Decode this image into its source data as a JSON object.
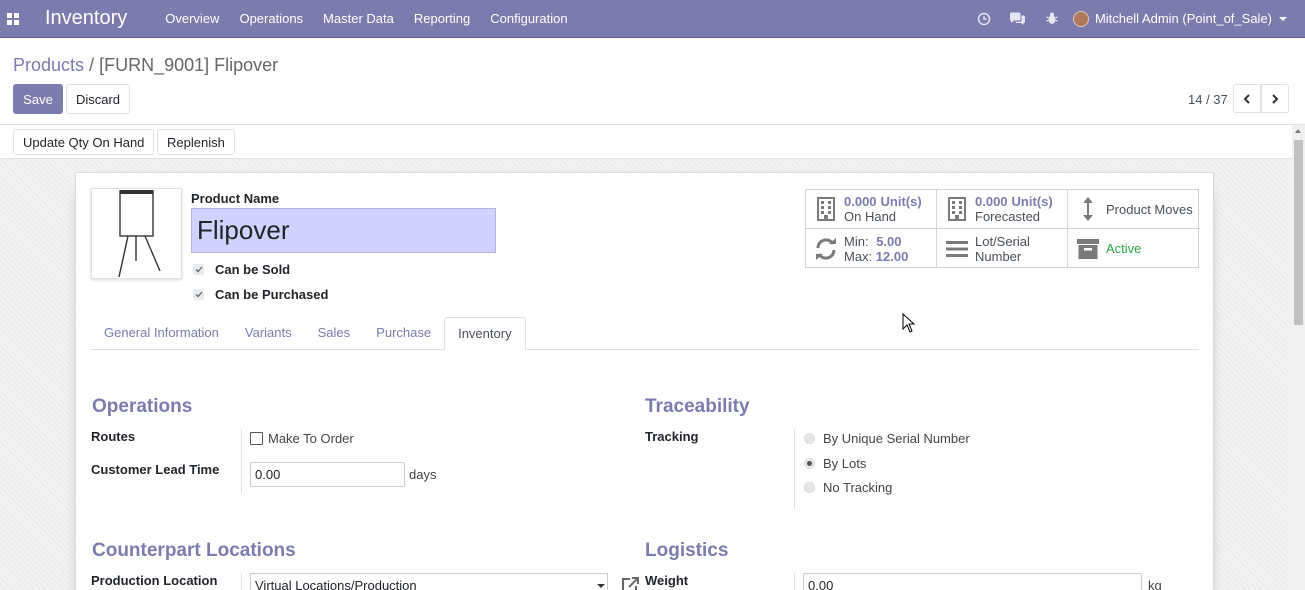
{
  "navbar": {
    "brand": "Inventory",
    "menu": [
      "Overview",
      "Operations",
      "Master Data",
      "Reporting",
      "Configuration"
    ],
    "user": "Mitchell Admin (Point_of_Sale)",
    "bg_color": "#7c7bad"
  },
  "breadcrumb": {
    "parent": "Products",
    "separator": "/",
    "current": "[FURN_9001] Flipover"
  },
  "actions": {
    "save": "Save",
    "discard": "Discard"
  },
  "pager": {
    "value": "14 / 37"
  },
  "statusbar": {
    "update_qty": "Update Qty On Hand",
    "replenish": "Replenish"
  },
  "product": {
    "name_label": "Product Name",
    "name": "Flipover",
    "can_be_sold": "Can be Sold",
    "can_be_purchased": "Can be Purchased",
    "can_be_sold_checked": true,
    "can_be_purchased_checked": true
  },
  "stats": {
    "on_hand_qty": "0.000",
    "on_hand_unit": "Unit(s)",
    "on_hand_label": "On Hand",
    "forecast_qty": "0.000",
    "forecast_unit": "Unit(s)",
    "forecast_label": "Forecasted",
    "moves_label": "Product Moves",
    "min_label": "Min:",
    "min_value": "5.00",
    "max_label": "Max:",
    "max_value": "12.00",
    "lot_label_1": "Lot/Serial",
    "lot_label_2": "Number",
    "active_label": "Active"
  },
  "tabs": [
    {
      "label": "General Information",
      "active": false
    },
    {
      "label": "Variants",
      "active": false
    },
    {
      "label": "Sales",
      "active": false
    },
    {
      "label": "Purchase",
      "active": false
    },
    {
      "label": "Inventory",
      "active": true
    }
  ],
  "operations": {
    "title": "Operations",
    "routes_label": "Routes",
    "make_to_order": "Make To Order",
    "make_to_order_checked": false,
    "lead_time_label": "Customer Lead Time",
    "lead_time_value": "0.00",
    "lead_time_suffix": "days"
  },
  "traceability": {
    "title": "Traceability",
    "tracking_label": "Tracking",
    "options": [
      "By Unique Serial Number",
      "By Lots",
      "No Tracking"
    ],
    "selected": "By Lots"
  },
  "counterpart": {
    "title": "Counterpart Locations",
    "production_label": "Production Location",
    "production_value": "Virtual Locations/Production"
  },
  "logistics": {
    "title": "Logistics",
    "weight_label": "Weight",
    "weight_value": "0.00",
    "weight_unit": "kg"
  }
}
